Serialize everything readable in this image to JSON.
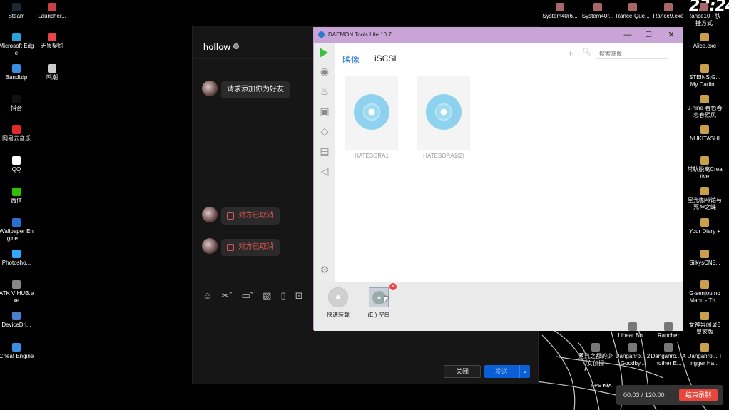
{
  "clock": {
    "time": "23:24"
  },
  "desktop_left": [
    {
      "label": "Steam",
      "icon": "steam-icon",
      "color": "#1b2838"
    },
    {
      "label": "Launcher...",
      "icon": "launcher-icon",
      "color": "#c94040"
    },
    {
      "label": "Microsoft Edge",
      "icon": "edge-icon",
      "color": "#2aa4d8"
    },
    {
      "label": "无畏契约",
      "icon": "valorant-icon",
      "color": "#e8454a"
    },
    {
      "label": "Bandizip",
      "icon": "bandizip-icon",
      "color": "#3a8de0"
    },
    {
      "label": "鸣潮",
      "icon": "wuthering-icon",
      "color": "#cccccc"
    },
    {
      "label": "抖音",
      "icon": "douyin-icon",
      "color": "#111111"
    },
    {
      "label": "网易云音乐",
      "icon": "netease-music-icon",
      "color": "#e02b2b"
    },
    {
      "label": "QQ",
      "icon": "qq-icon",
      "color": "#ffffff"
    },
    {
      "label": "微信",
      "icon": "wechat-icon",
      "color": "#2dc100"
    },
    {
      "label": "Wallpaper Engine: ...",
      "icon": "wallpaper-engine-icon",
      "color": "#2a6fd3"
    },
    {
      "label": "Photosho...",
      "icon": "photoshop-icon",
      "color": "#31a8ff"
    },
    {
      "label": "ATK V HUB.exe",
      "icon": "atk-icon",
      "color": "#888888"
    },
    {
      "label": "DeviceDri...",
      "icon": "device-driver-icon",
      "color": "#4a7fd0"
    },
    {
      "label": "Cheat Engine",
      "icon": "cheat-engine-icon",
      "color": "#3a8de0"
    }
  ],
  "desktop_top": [
    {
      "label": "System40r6...",
      "icon": "system40-icon"
    },
    {
      "label": "System40r...",
      "icon": "system40-icon"
    },
    {
      "label": "Rance-Que...",
      "icon": "rance-icon"
    },
    {
      "label": "Rance9.exe",
      "icon": "rance9-icon"
    },
    {
      "label": "Rance10 - 快捷方式",
      "icon": "rance10-icon"
    }
  ],
  "desktop_right": [
    {
      "label": "Alice.exe",
      "icon": "alice-icon"
    },
    {
      "label": "STEINS;G... My Darlin...",
      "icon": "steinsgate-icon"
    },
    {
      "label": "9-nine-春色春恋春熙风",
      "icon": "nine-icon"
    },
    {
      "label": "NUKITASHI",
      "icon": "nukitashi-icon"
    },
    {
      "label": "常轨脱离Creative",
      "icon": "creative-icon"
    },
    {
      "label": "星光咖啡馆与死神之蝶",
      "icon": "cafe-icon"
    },
    {
      "label": "Your Diary +",
      "icon": "diary-icon"
    },
    {
      "label": "SilkysCN5...",
      "icon": "silkys-icon"
    },
    {
      "label": "G-senjou no Maou - Th...",
      "icon": "gsenjou-icon"
    },
    {
      "label": "女神异闻录5皇家版",
      "icon": "persona5-icon"
    },
    {
      "label": "Danganro... Trigger Ha...",
      "icon": "danganronpa-icon"
    }
  ],
  "desktop_bottom": [
    {
      "label": "蒸汽之都的少女侦探",
      "icon": "steam-city-icon"
    },
    {
      "label": "Danganro... 2 Goodby...",
      "icon": "danganronpa2-icon"
    },
    {
      "label": "Danganro... Another E...",
      "icon": "danganronpa-ae-icon"
    },
    {
      "label": "Linear Bo...",
      "icon": "linear-icon"
    },
    {
      "label": "Rancher",
      "icon": "rancher-icon"
    }
  ],
  "chat": {
    "name": "hollow",
    "messages": [
      {
        "text": "请求添加你为好友",
        "type": "normal"
      },
      {
        "text": "对方已取消",
        "type": "cancel"
      },
      {
        "text": "对方已取消",
        "type": "cancel"
      }
    ],
    "toolbar": [
      "emoji-icon",
      "scissors-icon",
      "folder-icon",
      "image-icon",
      "video-icon",
      "box-icon"
    ],
    "close_label": "关闭",
    "send_label": "发送"
  },
  "daemon": {
    "title": "DAEMON Tools Lite 10.7",
    "tabs": [
      "映像",
      "iSCSI"
    ],
    "search_placeholder": "搜索映像",
    "images": [
      "HATESORA1",
      "HATESORA1(2)"
    ],
    "quick_mount_label": "快速装载",
    "drive_label": "(E:) 空白",
    "window_controls": [
      "—",
      "☐",
      "✕"
    ]
  },
  "recorder": {
    "fps_label": "FPS",
    "fps_value": "N/A",
    "time": "00:03 / 120:00",
    "stop_label": "结束录制"
  }
}
